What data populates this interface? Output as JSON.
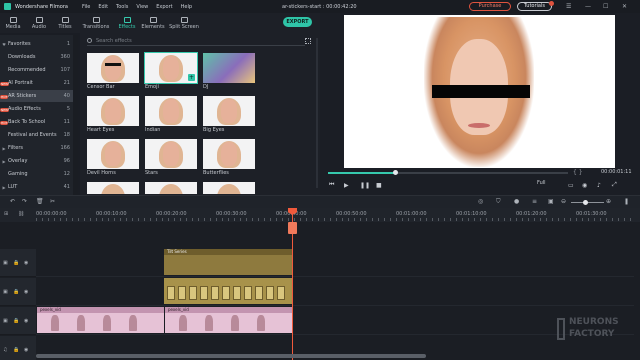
{
  "app": {
    "name": "Wondershare Filmora",
    "project_title": "ar-stickers-start : 00:00:42:20",
    "menu": [
      "File",
      "Edit",
      "Tools",
      "View",
      "Export",
      "Help"
    ],
    "purchase_label": "Purchase",
    "tutorials_label": "Tutorials",
    "win_controls": [
      "☰",
      "—",
      "☐",
      "✕"
    ]
  },
  "toolbar": {
    "tabs": [
      {
        "label": "Media"
      },
      {
        "label": "Audio"
      },
      {
        "label": "Titles"
      },
      {
        "label": "Transitions"
      },
      {
        "label": "Effects"
      },
      {
        "label": "Elements"
      },
      {
        "label": "Split Screen"
      }
    ],
    "active_tab": "Effects",
    "export_label": "EXPORT"
  },
  "sidebar": {
    "items": [
      {
        "label": "Favorites",
        "count": "1",
        "arrow": "♥"
      },
      {
        "label": "Downloads",
        "count": "360",
        "arrow": ""
      },
      {
        "label": "Recommended",
        "count": "107",
        "arrow": ""
      },
      {
        "label": "AI Portrait",
        "count": "21",
        "arrow": "",
        "tag": "NEW"
      },
      {
        "label": "AR Stickers",
        "count": "40",
        "arrow": "",
        "tag": "HOT"
      },
      {
        "label": "Audio Effects",
        "count": "5",
        "arrow": "",
        "tag": "NEW"
      },
      {
        "label": "Back To School",
        "count": "11",
        "arrow": "",
        "tag": "HOT"
      },
      {
        "label": "Festival and Events",
        "count": "18",
        "arrow": ""
      },
      {
        "label": "Filters",
        "count": "166",
        "arrow": "▶"
      },
      {
        "label": "Overlay",
        "count": "96",
        "arrow": "▶"
      },
      {
        "label": "Gaming",
        "count": "12",
        "arrow": ""
      },
      {
        "label": "LUT",
        "count": "41",
        "arrow": "▶"
      }
    ]
  },
  "effects": {
    "search_placeholder": "Search effects",
    "thumbnails": [
      {
        "label": "Censor Bar"
      },
      {
        "label": "Emoji"
      },
      {
        "label": "DJ"
      },
      {
        "label": "Heart Eyes"
      },
      {
        "label": "Indian"
      },
      {
        "label": "Big Eyes"
      },
      {
        "label": "Devil Horns"
      },
      {
        "label": "Stars"
      },
      {
        "label": "Butterflies"
      }
    ]
  },
  "preview": {
    "timecode": "00:00:01:11",
    "brackets": "{   }",
    "quality": "Full",
    "progress": 0.28
  },
  "timeline": {
    "ruler": [
      "00:00:00:00",
      "00:00:10:00",
      "00:00:20:00",
      "00:00:30:00",
      "00:00:40:00",
      "00:00:50:00",
      "00:01:00:00",
      "00:01:10:00",
      "00:01:20:00",
      "00:01:30:00"
    ],
    "title_clip": "Tilt Series",
    "video_clip_1": "pexels_vid",
    "video_clip_2": "pexels_vid"
  },
  "watermark": {
    "line1": "NEURONS",
    "line2": "FACTORY"
  }
}
